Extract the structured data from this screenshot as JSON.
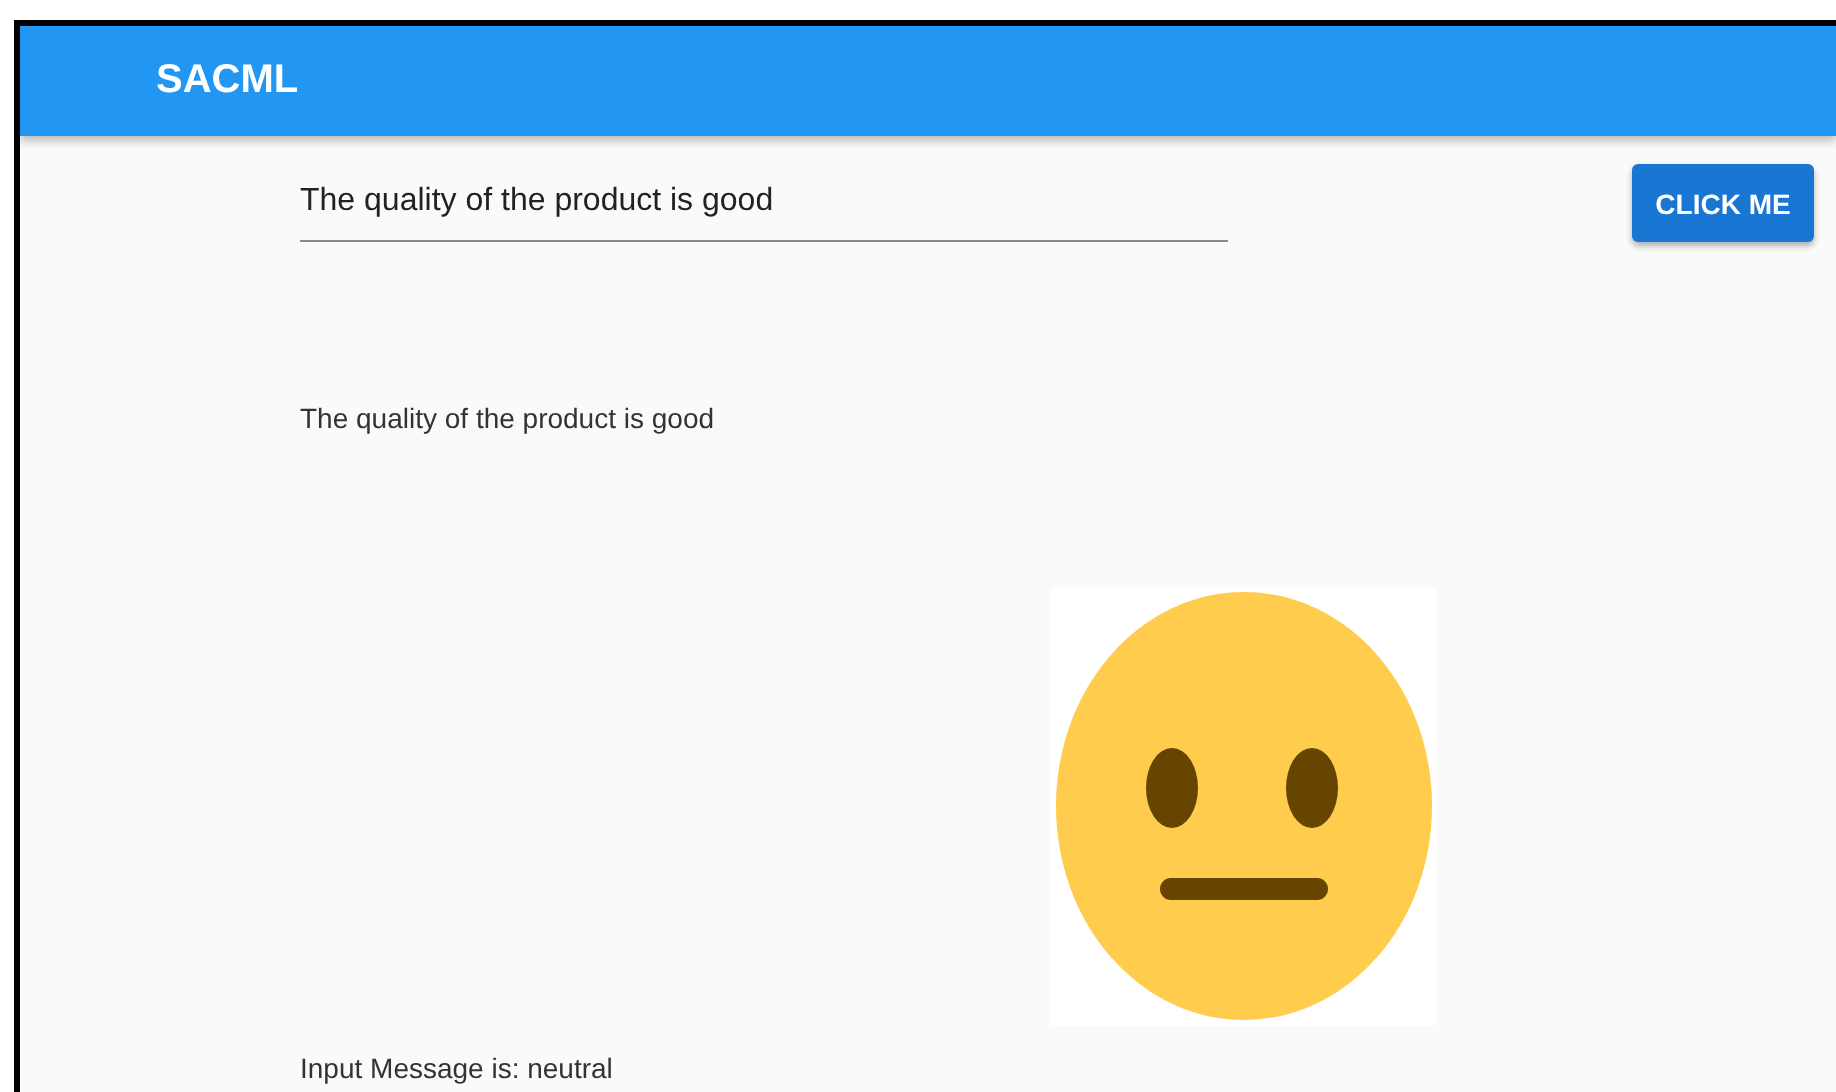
{
  "app_bar": {
    "title": "SACML"
  },
  "input": {
    "value": "The quality of the product is good"
  },
  "button": {
    "label": "CLICK ME"
  },
  "echo": "The quality of the product is good",
  "sentiment": {
    "kind": "neutral"
  },
  "result": "Input Message is:  neutral"
}
